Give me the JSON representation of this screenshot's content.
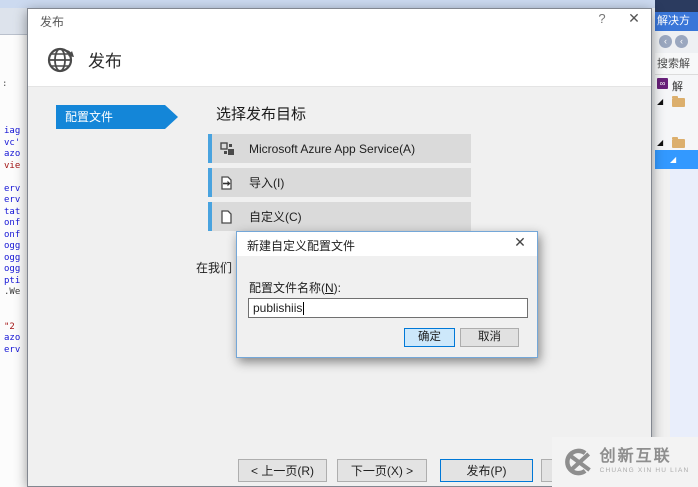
{
  "window": {
    "title": "发布",
    "help_glyph": "?",
    "close_glyph": "✕"
  },
  "header": {
    "title": "发布"
  },
  "sidebar": {
    "tab_label": "配置文件"
  },
  "main": {
    "heading": "选择发布目标",
    "targets": [
      {
        "label": "Microsoft Azure App Service(A)",
        "icon": "azure-app-service-icon"
      },
      {
        "label": "导入(I)",
        "icon": "import-icon"
      },
      {
        "label": "自定义(C)",
        "icon": "custom-profile-icon"
      }
    ],
    "clipped_text": "在我们"
  },
  "footer": {
    "prev_label": "< 上一页(R)",
    "next_label": "下一页(X) >",
    "publish_label": "发布(P)"
  },
  "modal": {
    "title": "新建自定义配置文件",
    "close_glyph": "✕",
    "label_prefix": "配置文件名称(",
    "label_key": "N",
    "label_suffix": "):",
    "input_value": "publishiis",
    "ok_label": "确定",
    "cancel_label": "取消"
  },
  "solution_panel": {
    "header": "解决方",
    "back_glyph": "‹",
    "forward_glyph": "‹",
    "search_text": "搜索解",
    "solution_icon_glyph": "∞",
    "solution_item": "解",
    "expand_glyph": "◢"
  },
  "editor": {
    "gutter_mark": ":",
    "lines": [
      {
        "text": "iag",
        "color": "blue"
      },
      {
        "text": "vc'",
        "color": "blue"
      },
      {
        "text": "azo",
        "color": "blue"
      },
      {
        "text": "vie",
        "color": "red"
      },
      {
        "text": "",
        "color": "blue"
      },
      {
        "text": "erv",
        "color": "blue"
      },
      {
        "text": "erv",
        "color": "blue"
      },
      {
        "text": "tat",
        "color": "blue"
      },
      {
        "text": "onf",
        "color": "blue"
      },
      {
        "text": "onf",
        "color": "blue"
      },
      {
        "text": "ogg",
        "color": "blue"
      },
      {
        "text": "ogg",
        "color": "blue"
      },
      {
        "text": "ogg",
        "color": "blue"
      },
      {
        "text": "pti",
        "color": "blue"
      },
      {
        "text": ".We",
        "color": "dark"
      },
      {
        "text": "",
        "color": "blue"
      },
      {
        "text": "",
        "color": "blue"
      },
      {
        "text": "\"2",
        "color": "red"
      },
      {
        "text": "azo",
        "color": "blue"
      },
      {
        "text": "erv",
        "color": "blue"
      }
    ]
  },
  "watermark": {
    "name": "创新互联",
    "sub": "CHUANG XIN HU LIAN"
  },
  "colors": {
    "accent_blue": "#1486d8",
    "selection_blue": "#3399ff",
    "default_button_border": "#0078d7",
    "sol_header_blue": "#3a76d8",
    "navy_strip": "#2b3b5f",
    "row_gray": "#dadada"
  }
}
